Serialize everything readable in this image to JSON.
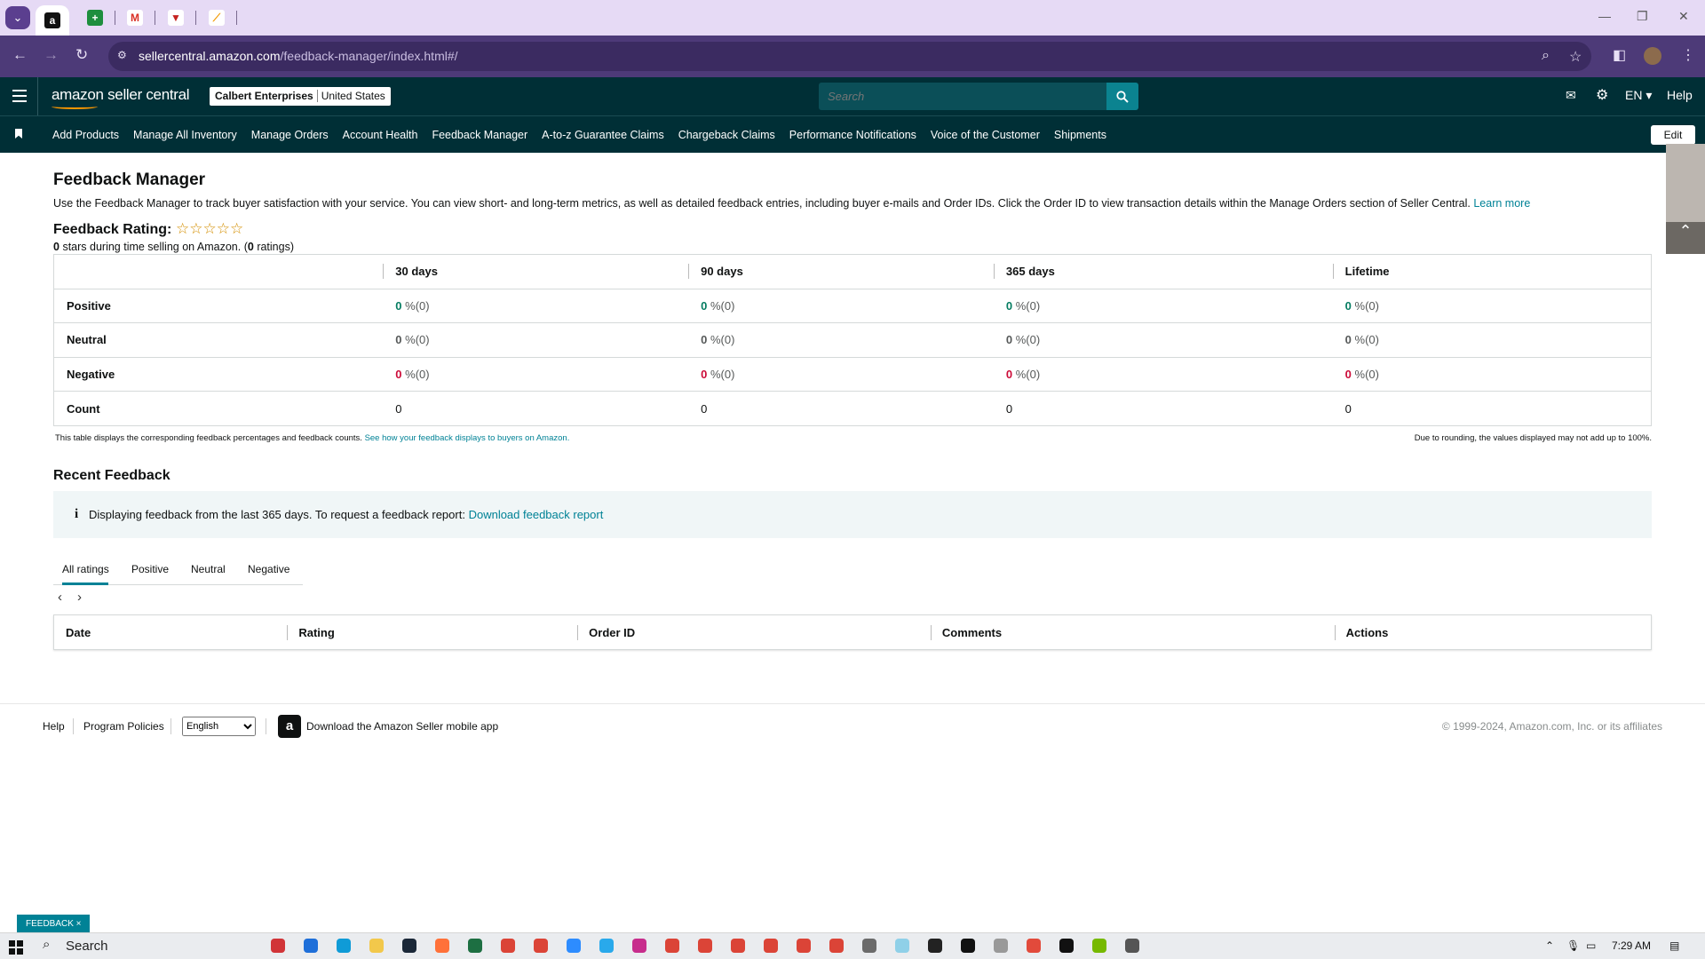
{
  "browser": {
    "url_host": "sellercentral.amazon.com",
    "url_path": "/feedback-manager/index.html#/"
  },
  "header": {
    "logo_text": "amazon seller central",
    "account_name": "Calbert Enterprises",
    "account_region": "United States",
    "search_placeholder": "Search",
    "language": "EN",
    "help": "Help"
  },
  "nav": {
    "items": [
      "Add Products",
      "Manage All Inventory",
      "Manage Orders",
      "Account Health",
      "Feedback Manager",
      "A-to-z Guarantee Claims",
      "Chargeback Claims",
      "Performance Notifications",
      "Voice of the Customer",
      "Shipments"
    ],
    "edit": "Edit"
  },
  "page": {
    "title": "Feedback Manager",
    "description": "Use the Feedback Manager to track buyer satisfaction with your service. You can view short- and long-term metrics, as well as detailed feedback entries, including buyer e-mails and Order IDs. Click the Order ID to view transaction details within the Manage Orders section of Seller Central.",
    "learn_more": "Learn more",
    "rating_title": "Feedback Rating:",
    "stars": "☆☆☆☆☆",
    "stars_value": "0",
    "rating_sub_text": "stars during time selling on Amazon. (",
    "rating_count": "0",
    "rating_sub_end": "ratings)"
  },
  "metrics": {
    "columns": [
      "30 days",
      "90 days",
      "365 days",
      "Lifetime"
    ],
    "rows": [
      {
        "label": "Positive",
        "cells": [
          "0",
          "0",
          "0",
          "0"
        ],
        "suffix": "%(0)"
      },
      {
        "label": "Neutral",
        "cells": [
          "0",
          "0",
          "0",
          "0"
        ],
        "suffix": "%(0)"
      },
      {
        "label": "Negative",
        "cells": [
          "0",
          "0",
          "0",
          "0"
        ],
        "suffix": "%(0)"
      },
      {
        "label": "Count",
        "cells": [
          "0",
          "0",
          "0",
          "0"
        ],
        "suffix": ""
      }
    ],
    "note_left": "This table displays the corresponding feedback percentages and feedback counts.",
    "note_link": "See how your feedback displays to buyers on Amazon.",
    "note_right": "Due to rounding, the values displayed may not add up to 100%."
  },
  "recent": {
    "title": "Recent Feedback",
    "info_text": "Displaying feedback from the last 365 days. To request a feedback report:",
    "info_link": "Download feedback report",
    "tabs": [
      "All ratings",
      "Positive",
      "Neutral",
      "Negative"
    ],
    "columns": [
      "Date",
      "Rating",
      "Order ID",
      "Comments",
      "Actions"
    ]
  },
  "footer": {
    "help": "Help",
    "policies": "Program Policies",
    "language_selected": "English",
    "app_text": "Download the Amazon Seller mobile app",
    "copyright": "© 1999-2024, Amazon.com, Inc. or its affiliates"
  },
  "feedback_tag": "FEEDBACK ×",
  "taskbar": {
    "search": "Search",
    "time": "7:29 AM"
  }
}
